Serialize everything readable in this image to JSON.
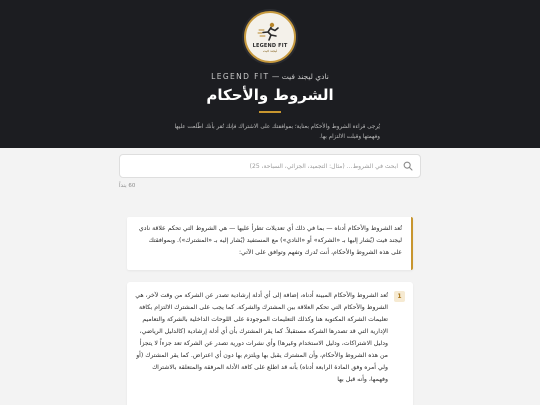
{
  "header": {
    "logo_text": "LEGEND FIT",
    "logo_subtext": "ليجند فيت",
    "brand_line": "نادي ليجند فيت — LEGEND FIT",
    "title": "الشروط والأحكام",
    "description": "يُرجى قراءة الشروط والأحكام بعناية؛ بموافقتك على الاشتراك فإنك تُقر بأنك اطّلعت عليها وفهمتها وقبلت الالتزام بها."
  },
  "search": {
    "placeholder": "ابحث في الشروط… (مثال: التجميد، الجزائي، السباحة، 25)"
  },
  "results": {
    "count_label": "60 بنداً"
  },
  "intro": {
    "text": "تُعد الشروط والأحكام أدناه — بما في ذلك أي تعديلات تطرأ عليها — هي الشروط التي تحكم علاقة نادي ليجند فيت (يُشار إليها بـ «الشركة» أو «النادي») مع المستفيد (يُشار إليه بـ «المشترك»). وبموافقتك على هذه الشروط والأحكام، أنت تُدرك وتفهم وتوافق على الآتي:"
  },
  "clauses": [
    {
      "number": "1",
      "text": "تُعد الشروط والأحكام المبينة أدناه، إضافة إلى أي أدلة إرشادية تصدر عن الشركة من وقت لآخر، هي الشروط والأحكام التي تحكم العلاقة بين المشترك والشركة. كما يجب على المشترك الالتزام بكافة تعليمات الشركة المكتوبة هنا وكذلك التعليمات الموجودة على اللوحات الداخلية بالشركة والتعاميم الإدارية التي قد تصدرها الشركة مستقبلاً. كما يقر المشترك بأن أي أدلة إرشادية (كالدليل الرياضي، ودليل الاشتراكات، ودليل الاستخدام وغيرها) وأي نشرات دورية تصدر عن الشركة تعد جزءاً لا يتجزأ من هذه الشروط والأحكام، وأن المشترك يقبل بها ويلتزم بها دون أي اعتراض. كما يقر المشترك (أو ولي أمره وفق المادة الرابعة أدناه) بأنه قد اطلع على كافة الأدلة المرفقة والمتعلقة بالاشتراك وفهمها، وأنه قبل بها"
    }
  ],
  "colors": {
    "hero_bg": "#1c1d21",
    "accent_gold": "#c8962f",
    "page_bg": "#f3f3f3"
  }
}
